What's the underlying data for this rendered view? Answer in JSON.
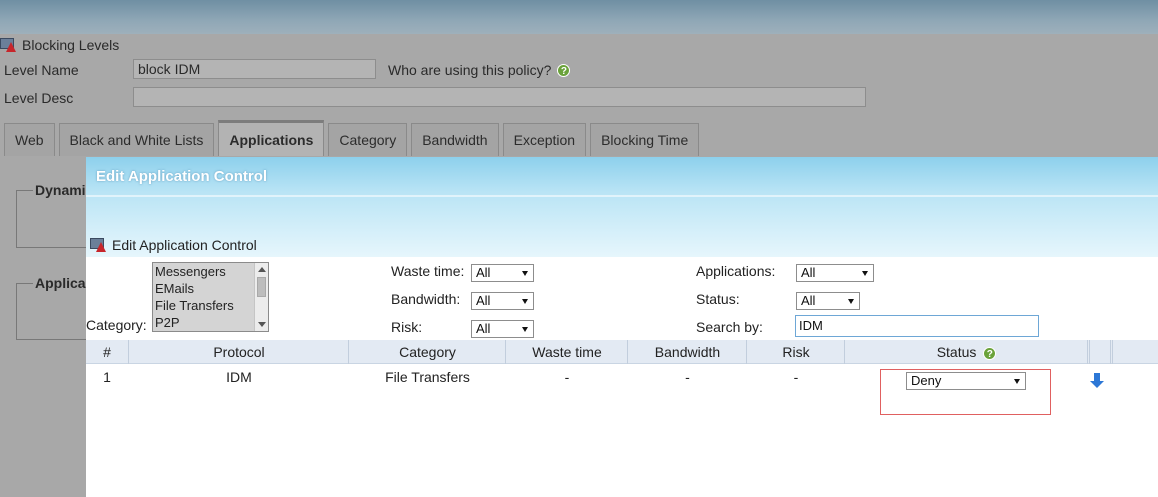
{
  "background": {
    "title": "Blocking Levels",
    "level_name_label": "Level Name",
    "level_name_value": "block IDM",
    "who_using": "Who are using this policy?",
    "level_desc_label": "Level Desc",
    "tabs": [
      "Web",
      "Black and White Lists",
      "Applications",
      "Category",
      "Bandwidth",
      "Exception",
      "Blocking Time"
    ],
    "active_tab": "Applications",
    "fieldset_1": "Dynami",
    "fieldset_2": "Applica"
  },
  "modal": {
    "title": "Edit Application Control",
    "subtitle": "Edit Application Control",
    "filters": {
      "category_label": "Category:",
      "category_options": [
        "Messengers",
        "EMails",
        "File Transfers",
        "P2P"
      ],
      "waste_time_label": "Waste time:",
      "waste_time_value": "All",
      "bandwidth_label": "Bandwidth:",
      "bandwidth_value": "All",
      "risk_label": "Risk:",
      "risk_value": "All",
      "applications_label": "Applications:",
      "applications_value": "All",
      "status_label": "Status:",
      "status_value": "All",
      "search_label": "Search by:",
      "search_value": "IDM"
    },
    "table": {
      "headers": [
        "#",
        "Protocol",
        "Category",
        "Waste time",
        "Bandwidth",
        "Risk",
        "Status"
      ],
      "rows": [
        {
          "num": "1",
          "protocol": "IDM",
          "category": "File Transfers",
          "waste_time": "-",
          "bandwidth": "-",
          "risk": "-",
          "status": "Deny"
        }
      ]
    }
  },
  "colors": {
    "header_gradient_top": "#8dd0ec",
    "table_header_bg": "#e3eaf3",
    "highlight_border": "#e06060",
    "help_icon": "#6aa23a",
    "download_icon": "#2c77d6"
  }
}
